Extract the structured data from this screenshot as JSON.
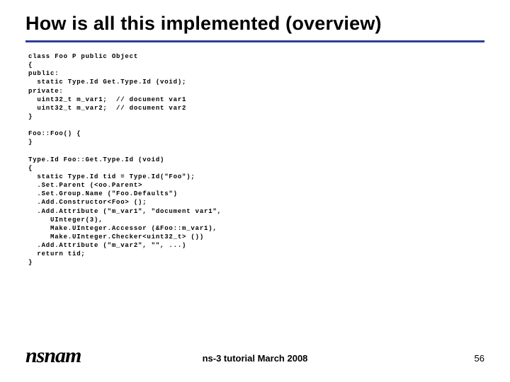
{
  "title": "How is all this implemented (overview)",
  "code": "class Foo P public Object\n{\npublic:\n  static Type.Id Get.Type.Id (void);\nprivate:\n  uint32_t m_var1;  // document var1\n  uint32_t m_var2;  // document var2\n}\n\nFoo::Foo() {\n}\n\nType.Id Foo::Get.Type.Id (void)\n{\n  static Type.Id tid = Type.Id(\"Foo\");\n  .Set.Parent (<oo.Parent>\n  .Set.Group.Name (\"Foo.Defaults\")\n  .Add.Constructor<Foo> ();\n  .Add.Attribute (\"m_var1\", \"document var1\",\n     UInteger(3),\n     Make.UInteger.Accessor (&Foo::m_var1),\n     Make.UInteger.Checker<uint32_t> ())\n  .Add.Attribute (\"m_var2\", \"\", ...)\n  return tid;\n}",
  "logo": "nsnam",
  "footer_text": "ns-3 tutorial March 2008",
  "page_number": "56"
}
